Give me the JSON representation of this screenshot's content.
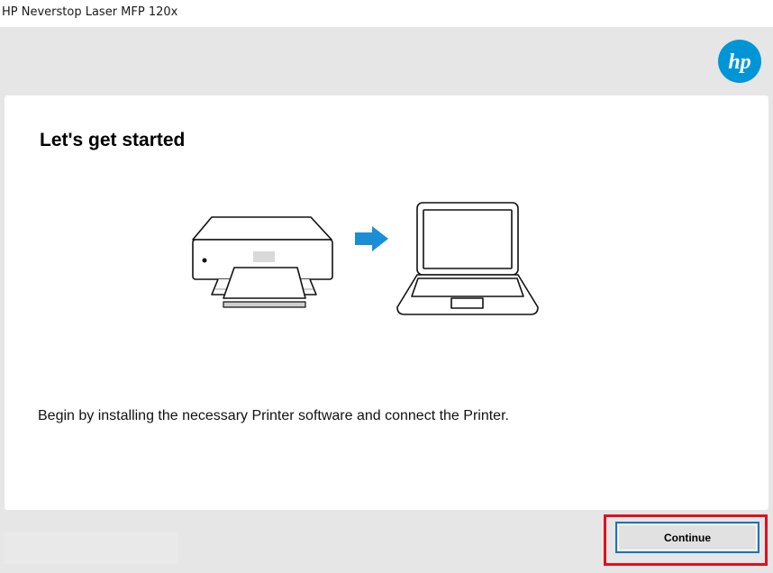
{
  "window": {
    "title": "HP Neverstop Laser MFP 120x"
  },
  "brand": {
    "logo_text": "hp",
    "logo_color": "#0096d6"
  },
  "main": {
    "heading": "Let's get started",
    "description": "Begin by installing the necessary Printer software and connect the Printer.",
    "illustration": {
      "left_icon": "printer-icon",
      "middle_icon": "arrow-right-icon",
      "right_icon": "laptop-icon",
      "arrow_color": "#1a8fd6"
    }
  },
  "footer": {
    "continue_label": "Continue",
    "highlight_color": "#e0101e",
    "button_border_color": "#1a73c6"
  }
}
